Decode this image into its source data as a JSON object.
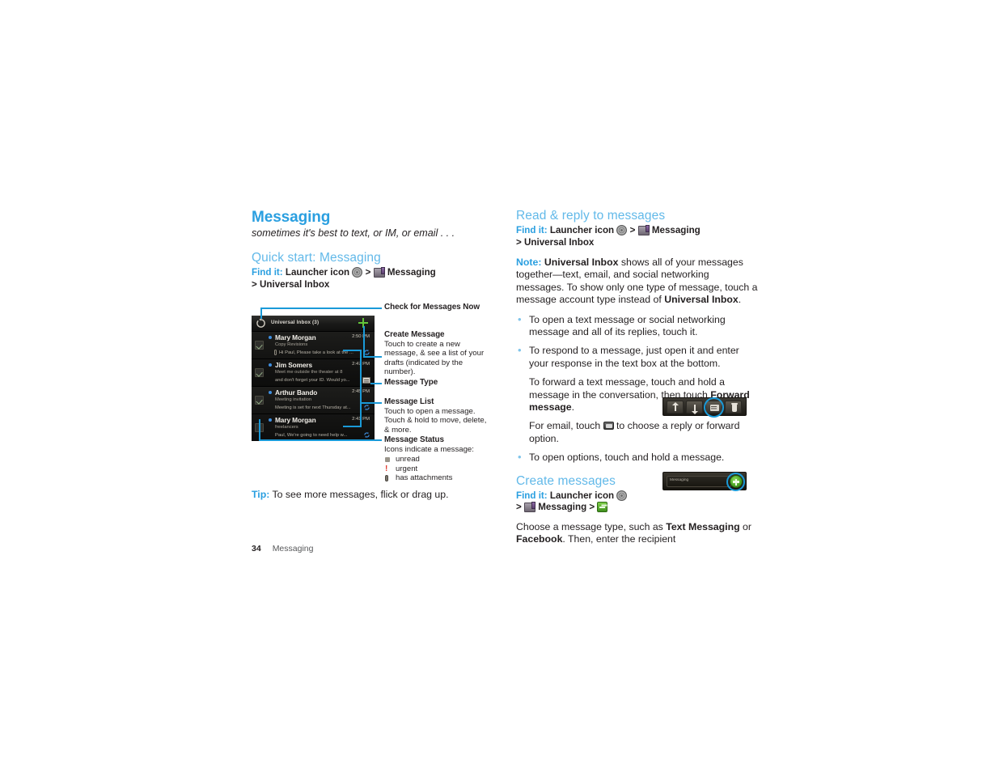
{
  "chapter": {
    "title": "Messaging",
    "subtitle": "sometimes it's best to text, or IM, or email . . ."
  },
  "quick_start": {
    "heading": "Quick start: Messaging",
    "findit_label": "Find it:",
    "findit_part1": "Launcher icon",
    "chevron1": ">",
    "findit_part2": "Messaging",
    "chevron2": ">",
    "findit_part3": "Universal Inbox"
  },
  "phone": {
    "header_title": "Universal Inbox (3)",
    "rows": [
      {
        "sender": "Mary Morgan",
        "time": "2:50 PM",
        "subject": "Copy Revisions",
        "preview": "Hi Paul, Please take a look at the ...",
        "type": "sync",
        "attachment": true,
        "checked": true,
        "unread": true
      },
      {
        "sender": "Jim Somers",
        "time": "2:47 PM",
        "subject": "Meet me outside the theater at 8",
        "preview": "and don't forget your ID. Would yo...",
        "type": "envelope",
        "attachment": false,
        "checked": true,
        "unread": true
      },
      {
        "sender": "Arthur Bando",
        "time": "2:45 PM",
        "subject": "Meeting invitation",
        "preview": "Meeting is set for next Thursday at...",
        "type": "sync",
        "attachment": false,
        "checked": true,
        "unread": true
      },
      {
        "sender": "Mary Morgan",
        "time": "2:41 PM",
        "subject": "freelancers",
        "preview": "Paul, We're going to need help w...",
        "type": "sync",
        "attachment": false,
        "checked": false,
        "unread": true
      }
    ]
  },
  "callouts": {
    "check_now": {
      "title": "Check for Messages Now",
      "desc": ""
    },
    "create_message": {
      "title": "Create Message",
      "desc": "Touch to create a new message, & see a list of your drafts (indicated by the number)."
    },
    "message_type": {
      "title": "Message Type",
      "desc": ""
    },
    "message_list": {
      "title": "Message List",
      "desc": "Touch to open a message. Touch & hold to move, delete, & more."
    },
    "message_status": {
      "title": "Message Status",
      "desc": "Icons indicate a message:",
      "items": [
        {
          "icon": "unread-icon",
          "label": "unread"
        },
        {
          "icon": "urgent-icon",
          "label": "urgent"
        },
        {
          "icon": "attachment-icon",
          "label": "has attachments"
        }
      ]
    }
  },
  "tip": {
    "label": "Tip:",
    "text": " To see more messages, flick or drag up."
  },
  "read_reply": {
    "heading": "Read & reply to messages",
    "findit_label": "Find it:",
    "findit_part1": "Launcher icon",
    "chevron1": ">",
    "findit_part2": "Messaging",
    "chevron2": ">",
    "findit_part3": "Universal Inbox",
    "note_label": "Note:",
    "note_bold1": "Universal Inbox",
    "note_text1": " shows all of your messages together—text, email, and social networking messages. To show only one type of message, touch a message account type instead of ",
    "note_bold2": "Universal Inbox",
    "note_text2": ".",
    "bullet1": "To open a text message or social networking message and all of its replies, touch it.",
    "bullet2": "To respond to a message, just open it and enter your response in the text box at the bottom.",
    "para_forward_a": "To forward a text message, touch and hold a message in the conversation, then touch ",
    "para_forward_bold": "Forward message",
    "para_forward_b": ".",
    "para_email_a": "For email, touch ",
    "para_email_b": " to choose a reply or forward option.",
    "bullet3": "To open options, touch and hold a message."
  },
  "create_messages": {
    "heading": "Create messages",
    "findit_label": "Find it:",
    "findit_part1": "Launcher icon",
    "chevron1": ">",
    "findit_part2": "Messaging",
    "chevron2": ">",
    "body_a": "Choose a message type, such as ",
    "body_bold1": "Text Messaging",
    "body_mid": " or ",
    "body_bold2": "Facebook",
    "body_b": ". Then, enter the recipient"
  },
  "widgets": {
    "compose_field_label": "Messaging"
  },
  "footer": {
    "page_number": "34",
    "chapter_name": "Messaging"
  },
  "colors": {
    "accent_blue": "#2a9fe0",
    "heading_blue": "#62b9e9",
    "callout_line": "#1a9ad8",
    "green": "#63c53a"
  }
}
